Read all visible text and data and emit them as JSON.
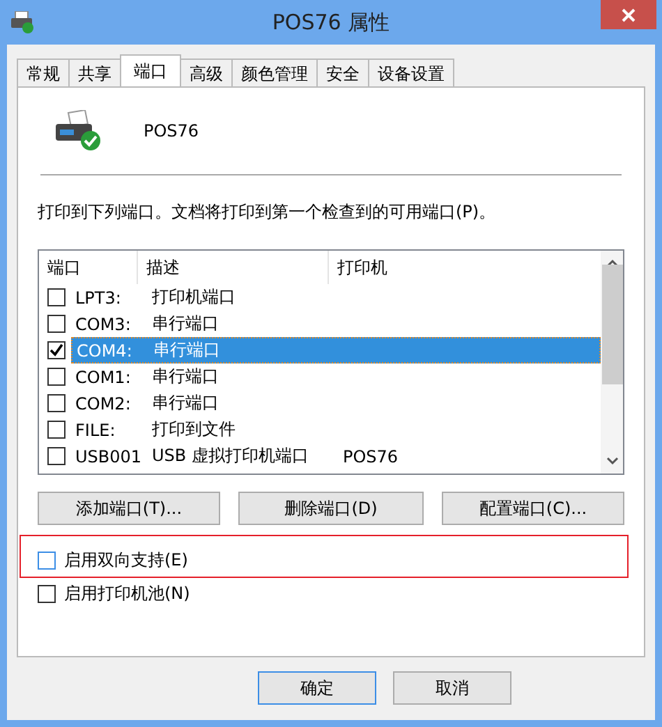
{
  "window": {
    "title": "POS76 属性"
  },
  "tabs": [
    {
      "label": "常规",
      "selected": false
    },
    {
      "label": "共享",
      "selected": false
    },
    {
      "label": "端口",
      "selected": true
    },
    {
      "label": "高级",
      "selected": false
    },
    {
      "label": "颜色管理",
      "selected": false
    },
    {
      "label": "安全",
      "selected": false
    },
    {
      "label": "设备设置",
      "selected": false
    }
  ],
  "printer_name": "POS76",
  "instruction": "打印到下列端口。文档将打印到第一个检查到的可用端口(P)。",
  "port_table": {
    "columns": [
      "端口",
      "描述",
      "打印机"
    ],
    "rows": [
      {
        "port": "LPT3:",
        "description": "打印机端口",
        "printer": "",
        "checked": false,
        "selected": false
      },
      {
        "port": "COM3:",
        "description": "串行端口",
        "printer": "",
        "checked": false,
        "selected": false
      },
      {
        "port": "COM4:",
        "description": "串行端口",
        "printer": "",
        "checked": true,
        "selected": true
      },
      {
        "port": "COM1:",
        "description": "串行端口",
        "printer": "",
        "checked": false,
        "selected": false
      },
      {
        "port": "COM2:",
        "description": "串行端口",
        "printer": "",
        "checked": false,
        "selected": false
      },
      {
        "port": "FILE:",
        "description": "打印到文件",
        "printer": "",
        "checked": false,
        "selected": false
      },
      {
        "port": "USB001",
        "description": "USB 虚拟打印机端口",
        "printer": "POS76",
        "checked": false,
        "selected": false
      }
    ]
  },
  "port_buttons": [
    "添加端口(T)...",
    "删除端口(D)",
    "配置端口(C)..."
  ],
  "options": [
    {
      "label": "启用双向支持(E)",
      "checked": false,
      "highlighted": true
    },
    {
      "label": "启用打印机池(N)",
      "checked": false,
      "highlighted": false
    }
  ],
  "dialog_buttons": [
    {
      "label": "确定",
      "default": true
    },
    {
      "label": "取消",
      "default": false
    }
  ]
}
